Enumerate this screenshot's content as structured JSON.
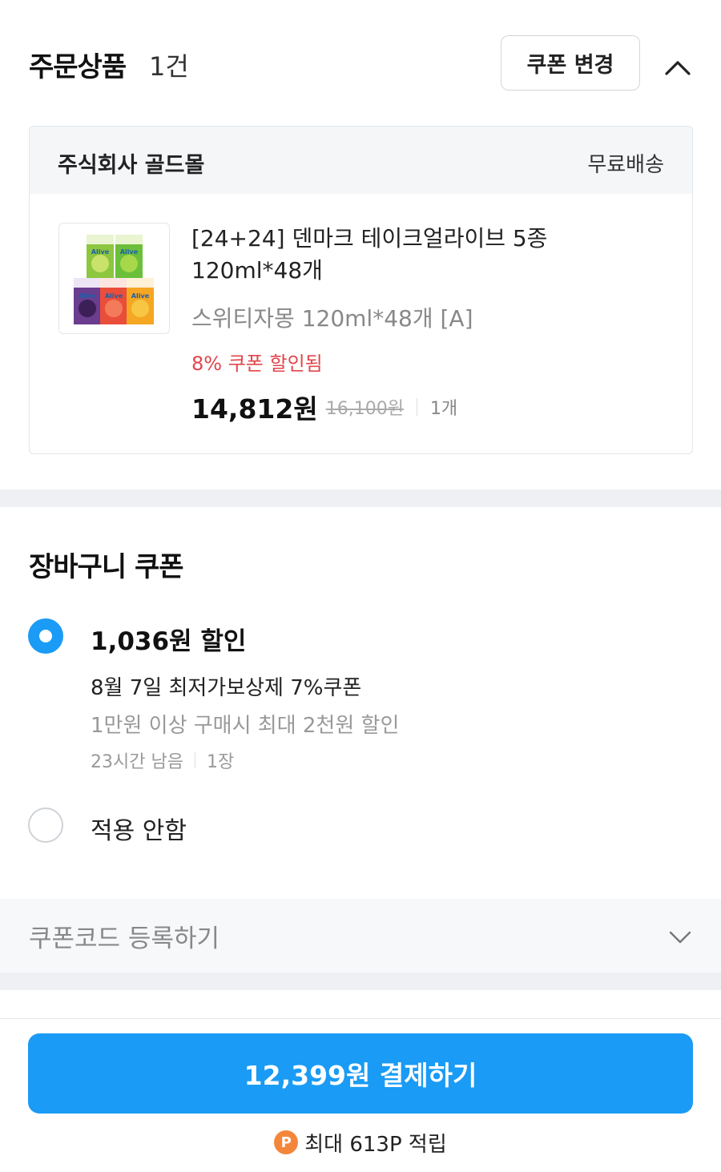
{
  "order": {
    "title": "주문상품",
    "count": "1건",
    "coupon_change_label": "쿠폰 변경"
  },
  "seller": {
    "name": "주식회사 골드몰",
    "shipping": "무료배송"
  },
  "product": {
    "name": "[24+24] 덴마크 테이크얼라이브 5종 120ml*48개",
    "option": "스위티자몽 120ml*48개 [A]",
    "coupon_applied": "8% 쿠폰 할인됨",
    "price": "14,812원",
    "original_price": "16,100원",
    "quantity": "1개",
    "thumb_brand": "Alive"
  },
  "basket_coupon": {
    "title": "장바구니 쿠폰",
    "options": [
      {
        "amount": "1,036원 할인",
        "name": "8월 7일 최저가보상제 7%쿠폰",
        "condition": "1만원 이상 구매시 최대 2천원 할인",
        "remaining": "23시간 남음",
        "count": "1장",
        "selected": true
      },
      {
        "label": "적용 안함",
        "selected": false
      }
    ]
  },
  "coupon_code": {
    "label": "쿠폰코드 등록하기"
  },
  "checkout": {
    "pay_label": "12,399원 결제하기",
    "points_icon": "P",
    "points_text": "최대 613P 적립"
  },
  "colors": {
    "accent": "#1a9bf5",
    "discount": "#e0474c",
    "points": "#f4863b"
  }
}
